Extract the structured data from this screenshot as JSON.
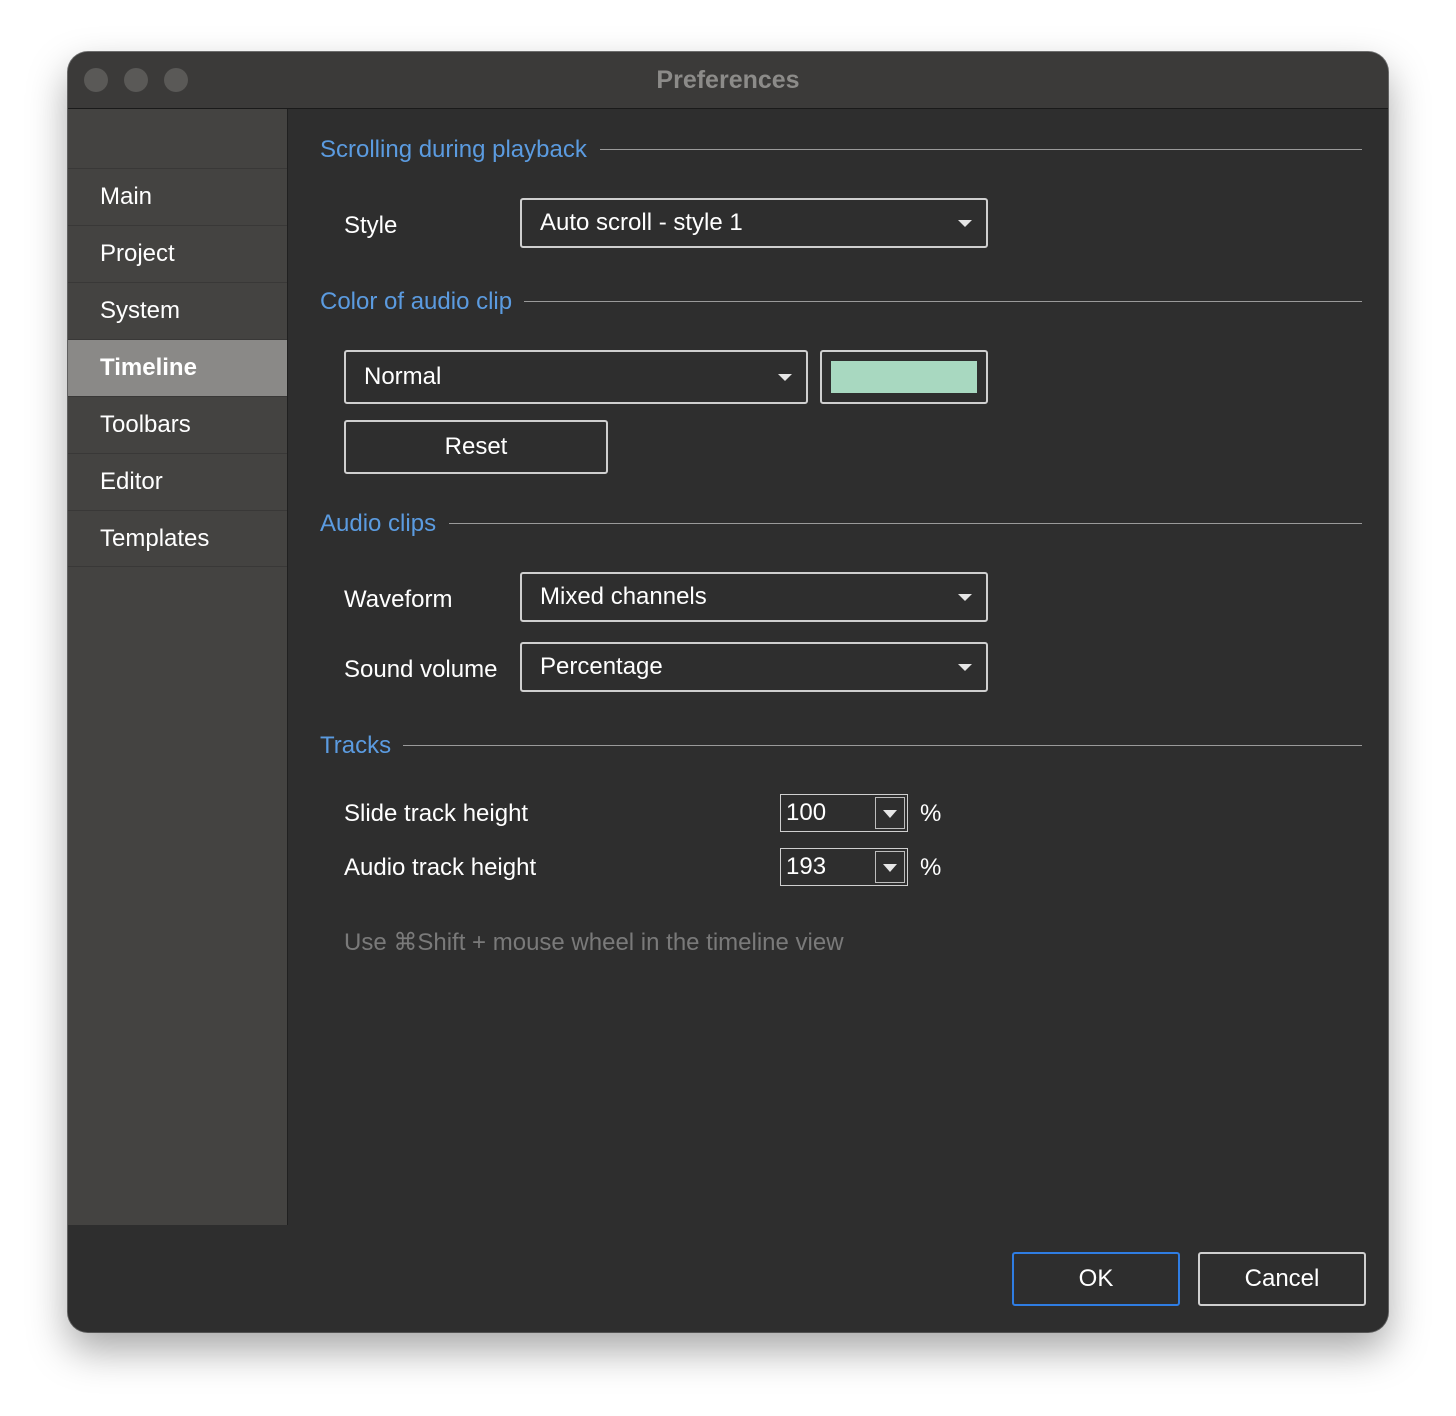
{
  "window": {
    "title": "Preferences"
  },
  "sidebar": {
    "items": [
      {
        "label": "Main"
      },
      {
        "label": "Project"
      },
      {
        "label": "System"
      },
      {
        "label": "Timeline",
        "selected": true
      },
      {
        "label": "Toolbars"
      },
      {
        "label": "Editor"
      },
      {
        "label": "Templates"
      }
    ]
  },
  "scrolling": {
    "section_title": "Scrolling during playback",
    "style_label": "Style",
    "style_value": "Auto scroll - style 1"
  },
  "color": {
    "section_title": "Color of audio clip",
    "mode_value": "Normal",
    "swatch_color": "#a8d8c0",
    "reset_label": "Reset"
  },
  "audio_clips": {
    "section_title": "Audio clips",
    "waveform_label": "Waveform",
    "waveform_value": "Mixed channels",
    "volume_label": "Sound volume",
    "volume_value": "Percentage"
  },
  "tracks": {
    "section_title": "Tracks",
    "slide_label": "Slide track height",
    "slide_value": "100",
    "slide_unit": "%",
    "audio_label": "Audio track height",
    "audio_value": "193",
    "audio_unit": "%",
    "hint": "Use ⌘Shift + mouse wheel in the timeline view"
  },
  "footer": {
    "ok_label": "OK",
    "cancel_label": "Cancel"
  },
  "colors": {
    "accent": "#5b9be0",
    "focus": "#2f7de3"
  }
}
